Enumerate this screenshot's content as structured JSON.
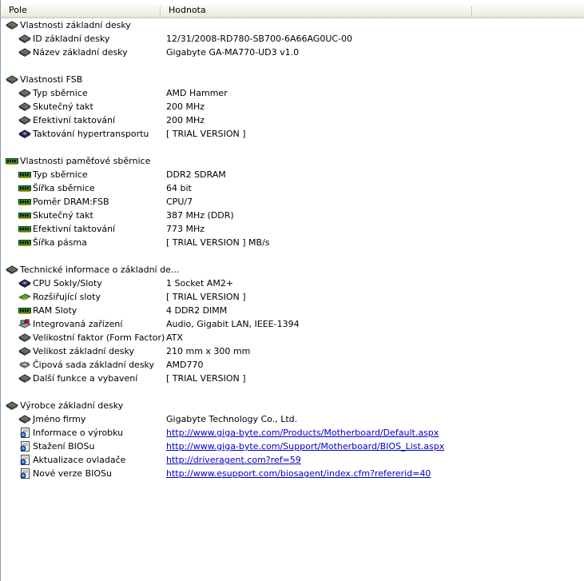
{
  "header": {
    "col1": "Pole",
    "col2": "Hodnota"
  },
  "sections": [
    {
      "title": "Vlastnosti základní desky",
      "icon": "motherboard-icon",
      "items": [
        {
          "label": "ID základní desky",
          "value": "12/31/2008-RD780-SB700-6A66AG0UC-00",
          "icon": "motherboard-icon"
        },
        {
          "label": "Název základní desky",
          "value": "Gigabyte GA-MA770-UD3 v1.0",
          "icon": "motherboard-icon"
        }
      ]
    },
    {
      "title": "Vlastnosti FSB",
      "icon": "motherboard-icon",
      "items": [
        {
          "label": "Typ sběrnice",
          "value": "AMD Hammer",
          "icon": "motherboard-icon"
        },
        {
          "label": "Skutečný takt",
          "value": "200 MHz",
          "icon": "motherboard-icon"
        },
        {
          "label": "Efektivní taktování",
          "value": "200 MHz",
          "icon": "motherboard-icon"
        },
        {
          "label": "Taktování hypertransportu",
          "value": "[ TRIAL VERSION ]",
          "icon": "cpu-icon"
        }
      ]
    },
    {
      "title": "Vlastnosti paměťové sběrnice",
      "icon": "memory-icon",
      "items": [
        {
          "label": "Typ sběrnice",
          "value": "DDR2 SDRAM",
          "icon": "memory-icon"
        },
        {
          "label": "Šířka sběrnice",
          "value": "64 bit",
          "icon": "memory-icon"
        },
        {
          "label": "Poměr DRAM:FSB",
          "value": "CPU/7",
          "icon": "memory-icon"
        },
        {
          "label": "Skutečný takt",
          "value": "387 MHz (DDR)",
          "icon": "memory-icon"
        },
        {
          "label": "Efektivní taktování",
          "value": "773 MHz",
          "icon": "memory-icon"
        },
        {
          "label": "Šířka pásma",
          "value": "[ TRIAL VERSION ] MB/s",
          "icon": "memory-icon"
        }
      ]
    },
    {
      "title": "Technické informace o základní de...",
      "icon": "motherboard-icon",
      "items": [
        {
          "label": "CPU Sokly/Sloty",
          "value": "1 Socket AM2+",
          "icon": "cpu-icon"
        },
        {
          "label": "Rozšiřující sloty",
          "value": "[ TRIAL VERSION ]",
          "icon": "expansion-card-icon"
        },
        {
          "label": "RAM Sloty",
          "value": "4 DDR2 DIMM",
          "icon": "memory-icon"
        },
        {
          "label": "Integrovaná zařízení",
          "value": "Audio, Gigabit LAN, IEEE-1394",
          "icon": "devices-icon"
        },
        {
          "label": "Velikostní faktor (Form Factor)",
          "value": "ATX",
          "icon": "motherboard-icon"
        },
        {
          "label": "Velikost základní desky",
          "value": "210 mm x 300 mm",
          "icon": "motherboard-icon"
        },
        {
          "label": "Čipová sada základní desky",
          "value": "AMD770",
          "icon": "chipset-icon"
        },
        {
          "label": "Další funkce a vybavení",
          "value": "[ TRIAL VERSION ]",
          "icon": "motherboard-icon"
        }
      ]
    },
    {
      "title": "Výrobce základní desky",
      "icon": "motherboard-icon",
      "items": [
        {
          "label": "Jméno firmy",
          "value": "Gigabyte Technology Co., Ltd.",
          "icon": "motherboard-icon"
        },
        {
          "label": "Informace o výrobku",
          "value": "http://www.giga-byte.com/Products/Motherboard/Default.aspx",
          "icon": "web-page-icon",
          "link": true
        },
        {
          "label": "Stažení BIOSu",
          "value": "http://www.giga-byte.com/Support/Motherboard/BIOS_List.aspx",
          "icon": "web-page-icon",
          "link": true
        },
        {
          "label": "Aktualizace ovladače",
          "value": "http://driveragent.com?ref=59",
          "icon": "web-page-icon",
          "link": true
        },
        {
          "label": "Nové verze BIOSu",
          "value": "http://www.esupport.com/biosagent/index.cfm?refererid=40",
          "icon": "web-page-icon",
          "link": true
        }
      ]
    }
  ],
  "colors": {
    "link": "#0000c8",
    "header_bg": "#ebeadb",
    "row_text": "#000000"
  }
}
